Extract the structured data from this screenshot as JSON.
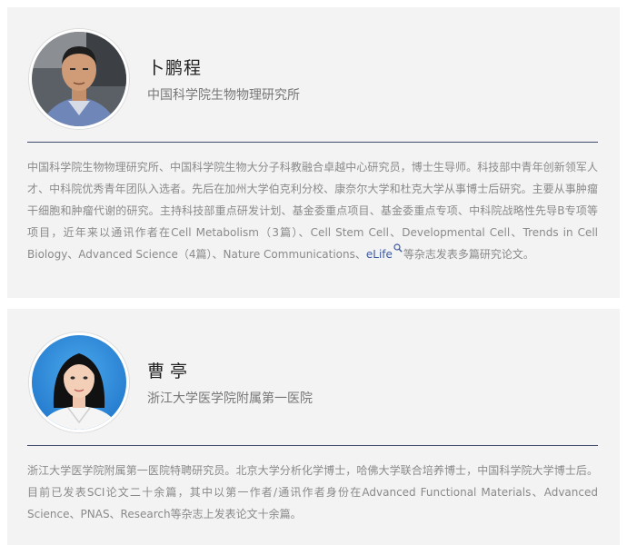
{
  "profiles": [
    {
      "name": "卜鹏程",
      "org": "中国科学院生物物理研究所",
      "bio_pre": "中国科学院生物物理研究所、中国科学院生物大分子科教融合卓越中心研究员，博士生导师。科技部中青年创新领军人才、中科院优秀青年团队入选者。先后在加州大学伯克利分校、康奈尔大学和杜克大学从事博士后研究。主要从事肿瘤干细胞和肿瘤代谢的研究。主持科技部重点研发计划、基金委重点项目、基金委重点专项、中科院战略性先导B专项等项目，近年来以通讯作者在Cell Metabolism（3篇）、Cell Stem Cell、Developmental Cell、Trends in Cell Biology、Advanced Science（4篇）、Nature Communications、",
      "bio_link": "eLife",
      "bio_post": "等杂志发表多篇研究论文。"
    },
    {
      "name": "曹亭",
      "org": "浙江大学医学院附属第一医院",
      "bio": "浙江大学医学院附属第一医院特聘研究员。北京大学分析化学博士，哈佛大学联合培养博士，中国科学院大学博士后。目前已发表SCI论文二十余篇，其中以第一作者/通讯作者身份在Advanced Functional Materials、Advanced Science、PNAS、Research等杂志上发表论文十余篇。"
    }
  ],
  "icons": {
    "link_search": "search-icon"
  },
  "colors": {
    "card_bg": "#f3f3f3",
    "divider": "#3e4a6b",
    "link": "#3d5a9e"
  }
}
